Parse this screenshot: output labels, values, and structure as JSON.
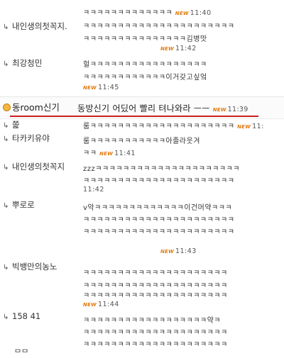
{
  "top_partial": {
    "lines": [
      "ㅋㅋㅋㅋㅋㅋㅋㅋㅋㅋㅋㅋㅋ"
    ],
    "new": "NEW",
    "time": "11:40"
  },
  "comments": [
    {
      "nick": "내인생의첫꼭지.",
      "lines": [
        "ㅋㅋㅋㅋㅋㅋㅋㅋㅋㅋㅋㅋㅋㅋㅋㅋㅋㅋㅋㅋㅋㅋ",
        "ㅋㅋㅋㅋㅋㅋㅋㅋㅋㅋㅋㅋㅋㅋㅋ김병맛"
      ],
      "new": "NEW",
      "time": "11:42"
    },
    {
      "nick": "최강청민",
      "lines": [
        "헐ㅋㅋㅋㅋㅋㅋㅋㅋㅋㅋㅋㅋㅋㅋㅋㅋㅋ",
        "ㅋㅋㅋㅋㅋㅋㅋㅋㅋㅋㅋㅋ이거갖고싶엌"
      ],
      "new": "NEW",
      "time": "11:45"
    }
  ],
  "main_comment": {
    "nick": "동room신기",
    "text": "동방신기 어딨어 빨리 텨나와라 ㅡㅡ",
    "new": "NEW",
    "time": "11:39"
  },
  "replies": [
    {
      "nick": "쫉",
      "lines": [
        "룸ㅋㅋㅋㅋㅋㅋㅋㅋㅋㅋㅋㅋㅋㅋㅋㅋㅋㅋㅋㅋㅋ"
      ],
      "new": "NEW",
      "time": "11:"
    },
    {
      "nick": "타카키유야",
      "lines": [
        "룸ㅋㅋㅋㅋㅋㅋㅋㅋㅋㅋㅋ아졸라웃겨",
        "ㅋㅋ"
      ],
      "new": "NEW",
      "time": "11:41"
    },
    {
      "nick": "내인생의첫꼭지",
      "lines": [
        "zzzㅋㅋㅋㅋㅋㅋㅋㅋㅋㅋㅋㅋㅋㅋㅋㅋㅋㅋㅋㅋㅋ",
        "ㅋㅋㅋㅋㅋㅋㅋㅋㅋㅋㅋㅋㅋㅋㅋㅋㅋㅋㅋㅋㅋㅋ"
      ],
      "time": "11:42"
    },
    {
      "nick": "뿌로로",
      "lines": [
        "v악ㅋㅋㅋㅋㅋㅋㅋㅋㅋㅋㅋㅋㅋ이건머약ㅋㅋㅋ",
        "ㅋㅋㅋㅋㅋㅋㅋㅋㅋㅋㅋㅋㅋㅋㅋㅋㅋㅋㅋㅋㅋㅋ",
        "ㅋㅋㅋㅋㅋㅋㅋㅋㅋㅋㅋㅋㅋㅋㅋㅋㅋㅋㅋㅋㅋㅋ"
      ],
      "new": "NEW",
      "time": "11:43"
    },
    {
      "nick": "빅뱅만의농노",
      "lines": [
        "ㅋㅋㅋㅋㅋㅋㅋㅋㅋㅋㅋㅋㅋㅋㅋㅋㅋㅋㅋㅋㅋ",
        "ㅋㅋㅋㅋㅋㅋㅋㅋㅋㅋㅋㅋㅋㅋㅋㅋㅋㅋㅋㅋㅋ",
        "ㅋㅋㅋㅋㅋㅋㅋㅋㅋㅋㅋㅋㅋㅋㅋㅋㅋㅋㅋㅋㅋ"
      ],
      "new": "NEW",
      "time": "11:44"
    },
    {
      "nick": "158 41",
      "lines": [
        "ㅋㅋㅋㅋㅋㅋㅋㅋㅋㅋㅋㅋㅋㅋㅋㅋㅋㅋ약ㅋ",
        "ㅋㅋㅋㅋㅋㅋㅋㅋㅋㅋㅋㅋㅋㅋㅋㅋㅋㅋㅋㅋㅋ",
        "ㅋㅋㅋㅋㅋㅋㅋㅋㅋㅋㅋㅋㅋㅋㅋㅋㅋㅋㅋㅋㅋ"
      ]
    }
  ],
  "bottom_fragment": "ᄆᄆ"
}
